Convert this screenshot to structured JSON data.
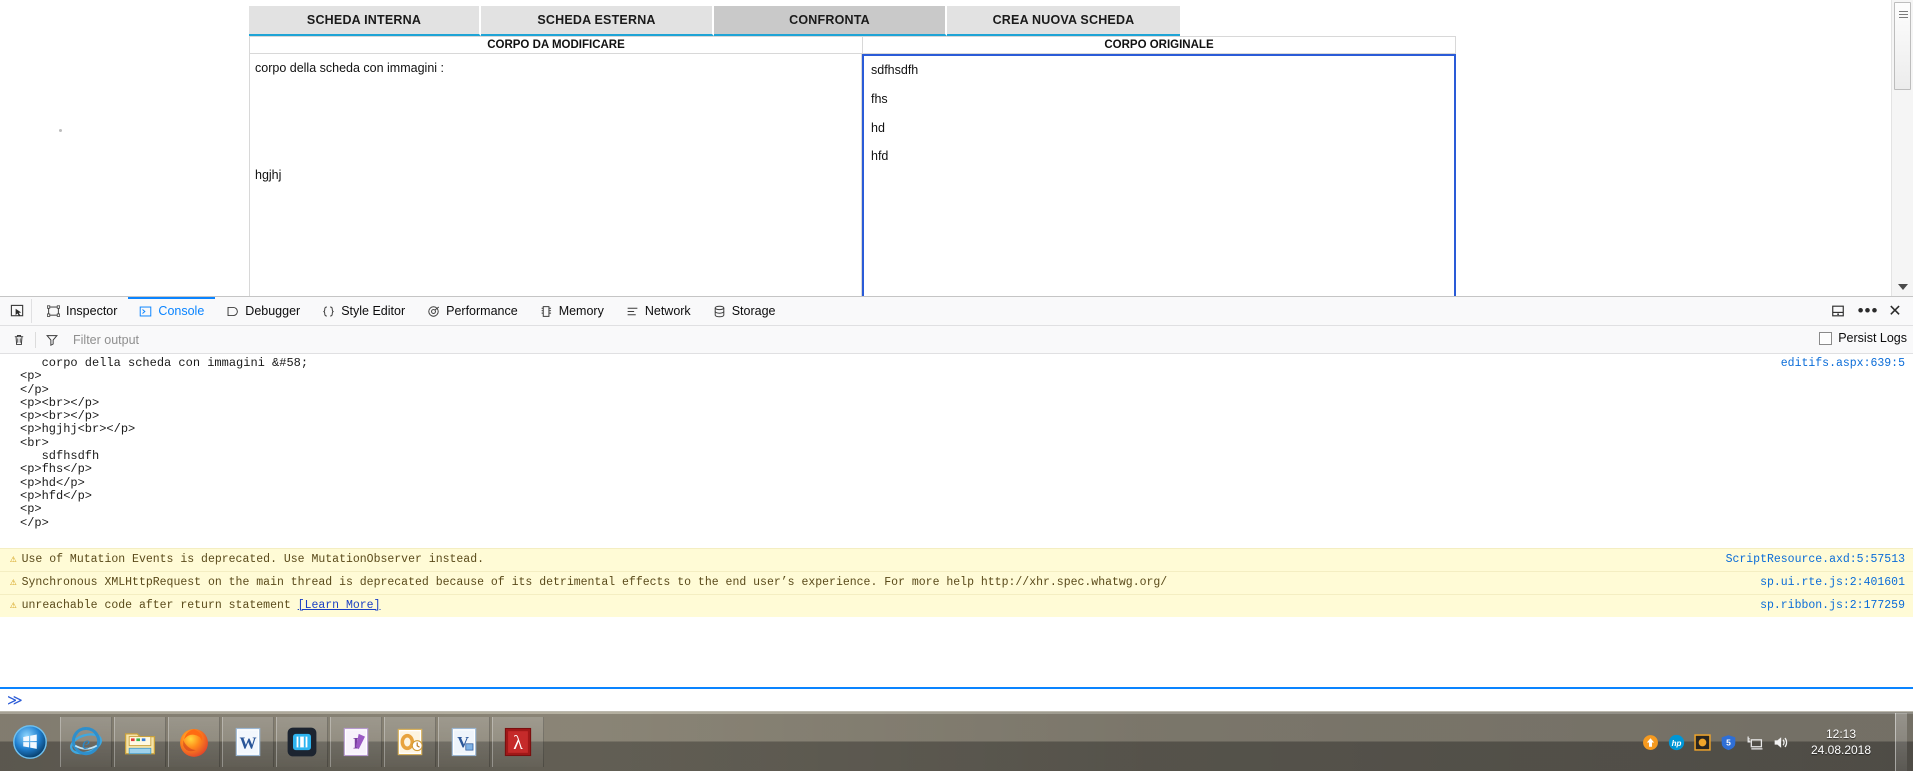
{
  "page": {
    "tabs": [
      {
        "label": "SCHEDA INTERNA",
        "active": false
      },
      {
        "label": "SCHEDA ESTERNA",
        "active": false
      },
      {
        "label": "CONFRONTA",
        "active": true
      },
      {
        "label": "CREA NUOVA SCHEDA",
        "active": false
      }
    ],
    "columns": {
      "left_header": "CORPO DA MODIFICARE",
      "right_header": "CORPO ORIGINALE"
    },
    "left_body": [
      "corpo della scheda con immagini :",
      "",
      "",
      "",
      "hgjhj"
    ],
    "right_body": [
      "sdfhsdfh",
      "fhs",
      "hd",
      "hfd"
    ]
  },
  "devtools": {
    "picker_icon": "element-picker-icon",
    "tabs": [
      {
        "label": "Inspector",
        "icon": "inspector-icon",
        "active": false
      },
      {
        "label": "Console",
        "icon": "console-icon",
        "active": true
      },
      {
        "label": "Debugger",
        "icon": "debugger-icon",
        "active": false
      },
      {
        "label": "Style Editor",
        "icon": "style-editor-icon",
        "active": false
      },
      {
        "label": "Performance",
        "icon": "performance-icon",
        "active": false
      },
      {
        "label": "Memory",
        "icon": "memory-icon",
        "active": false
      },
      {
        "label": "Network",
        "icon": "network-icon",
        "active": false
      },
      {
        "label": "Storage",
        "icon": "storage-icon",
        "active": false
      }
    ],
    "right_buttons": [
      {
        "name": "dock-to-bottom-icon",
        "label": ""
      },
      {
        "name": "more-options-icon",
        "label": "•••"
      },
      {
        "name": "close-icon",
        "label": "✕"
      }
    ],
    "filterbar": {
      "trash_icon": "trash-icon",
      "filter_icon": "filter-icon",
      "placeholder": "Filter output",
      "value": "",
      "persist_label": "Persist Logs",
      "persist_checked": false
    },
    "log_block": {
      "source": "editifs.aspx:639:5",
      "lines": [
        "   corpo della scheda con immagini &#58;",
        "<p>",
        "</p>",
        "<p><br></p>",
        "<p><br></p>",
        "<p>hgjhj<br></p>",
        "<br>",
        "   sdfhsdfh",
        "<p>fhs</p>",
        "<p>hd</p>",
        "<p>hfd</p>",
        "<p>",
        "</p>"
      ]
    },
    "warnings": [
      {
        "text": "Use of Mutation Events is deprecated. Use MutationObserver instead.",
        "link": "",
        "source": "ScriptResource.axd:5:57513"
      },
      {
        "text": "Synchronous XMLHttpRequest on the main thread is deprecated because of its detrimental effects to the end user’s experience. For more help http://xhr.spec.whatwg.org/",
        "link": "",
        "source": "sp.ui.rte.js:2:401601"
      },
      {
        "text": "unreachable code after return statement ",
        "link": "[Learn More]",
        "source": "sp.ribbon.js:2:177259"
      }
    ],
    "input_prompt": "≫",
    "input_value": ""
  },
  "taskbar": {
    "start_label": "start-orb",
    "items": [
      {
        "name": "taskbar-internet-explorer",
        "label": "Internet Explorer"
      },
      {
        "name": "taskbar-file-explorer",
        "label": "File Explorer"
      },
      {
        "name": "taskbar-firefox",
        "label": "Mozilla Firefox"
      },
      {
        "name": "taskbar-word",
        "label": "Microsoft Word"
      },
      {
        "name": "taskbar-app-blue",
        "label": "Application"
      },
      {
        "name": "taskbar-infopath",
        "label": "InfoPath"
      },
      {
        "name": "taskbar-outlook",
        "label": "Microsoft Outlook"
      },
      {
        "name": "taskbar-visio",
        "label": "Microsoft Visio"
      },
      {
        "name": "taskbar-acrobat",
        "label": "Adobe Acrobat"
      }
    ],
    "tray": [
      {
        "name": "tray-update-icon",
        "label": ""
      },
      {
        "name": "tray-hp-icon",
        "label": "hp"
      },
      {
        "name": "tray-orange-icon",
        "label": ""
      },
      {
        "name": "tray-shield-icon",
        "label": ""
      },
      {
        "name": "tray-network-icon",
        "label": ""
      },
      {
        "name": "tray-volume-icon",
        "label": ""
      }
    ],
    "clock_time": "12:13",
    "clock_date": "24.08.2018"
  },
  "colors": {
    "tab_underline": "#1fa4d6",
    "tab_active_bg": "#c9c9c9",
    "editor_focus_border": "#2a5bd7",
    "devtools_accent": "#0a84ff",
    "warn_bg": "#fffbd6",
    "source_link": "#0a6cd8"
  }
}
